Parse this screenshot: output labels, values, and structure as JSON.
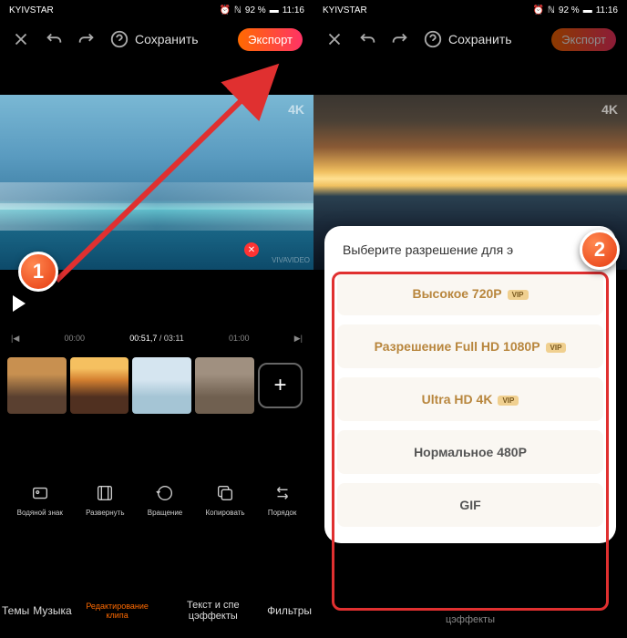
{
  "statusbar": {
    "carrier": "KYIVSTAR",
    "battery": "92 %",
    "time": "11:16"
  },
  "topbar": {
    "save": "Сохранить",
    "export": "Экспорт"
  },
  "video": {
    "badge_4k": "4K",
    "watermark": "VIVAVIDEO"
  },
  "timeline": {
    "left": "00:00",
    "current": "00:51,7",
    "total": "03:11",
    "right": "01:00"
  },
  "tools": [
    {
      "label": "Водяной знак"
    },
    {
      "label": "Развернуть"
    },
    {
      "label": "Вращение"
    },
    {
      "label": "Копировать"
    },
    {
      "label": "Порядок"
    }
  ],
  "tabs": {
    "themes": "Темы",
    "music": "Музыка",
    "edit": "Редактирование клипа",
    "text": "Текст и спе цэффекты",
    "filters": "Фильтры"
  },
  "modal": {
    "title": "Выберите разрешение для э",
    "options": [
      {
        "label": "Высокое 720P",
        "vip": true
      },
      {
        "label": "Разрешение Full HD 1080P",
        "vip": true
      },
      {
        "label": "Ultra HD 4K",
        "vip": true
      },
      {
        "label": "Нормальное 480P",
        "vip": false
      },
      {
        "label": "GIF",
        "vip": false
      }
    ],
    "vip_text": "VIP"
  },
  "markers": {
    "one": "1",
    "two": "2"
  },
  "tabs_right": {
    "effects": "цэффекты"
  }
}
